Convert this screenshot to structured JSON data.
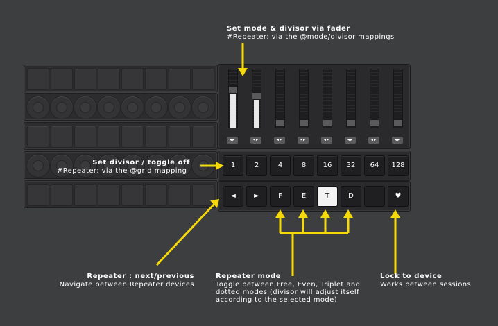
{
  "fader_panel": {
    "faders": [
      {
        "fill": 0.7,
        "cap": 0.68
      },
      {
        "fill": 0.58,
        "cap": 0.56
      },
      {
        "fill": 0.0,
        "cap": 0.0
      },
      {
        "fill": 0.0,
        "cap": 0.0
      },
      {
        "fill": 0.0,
        "cap": 0.0
      },
      {
        "fill": 0.0,
        "cap": 0.0
      },
      {
        "fill": 0.0,
        "cap": 0.0
      },
      {
        "fill": 0.0,
        "cap": 0.0
      }
    ],
    "arrow_glyph": "◂▸"
  },
  "divisor_buttons": [
    "1",
    "2",
    "4",
    "8",
    "16",
    "32",
    "64",
    "128"
  ],
  "control_buttons": [
    {
      "label": "◄",
      "lit": false
    },
    {
      "label": "►",
      "lit": false
    },
    {
      "label": "F",
      "lit": false
    },
    {
      "label": "E",
      "lit": false
    },
    {
      "label": "T",
      "lit": true
    },
    {
      "label": "D",
      "lit": false
    },
    {
      "label": "",
      "lit": false
    },
    {
      "label": "♥",
      "lit": false
    }
  ],
  "annotations": {
    "fader": {
      "title": "Set mode & divisor via fader",
      "subtitle": "#Repeater: via the @mode/divisor mappings"
    },
    "divisor": {
      "title": "Set divisor / toggle off",
      "subtitle": "#Repeater: via the @grid mapping"
    },
    "nav": {
      "title": "Repeater : next/previous",
      "subtitle": "Navigate between Repeater devices"
    },
    "mode": {
      "title": "Repeater mode",
      "line1": "Toggle between Free, Even, Triplet and",
      "line2": "dotted modes (divisor will adjust itself",
      "line3": "according to the selected mode)"
    },
    "lock": {
      "title": "Lock to device",
      "subtitle": "Works between sessions"
    }
  },
  "colors": {
    "background": "#3d3e40",
    "annotation": "#f5d90a",
    "lit_button": "#f2f2f2"
  }
}
